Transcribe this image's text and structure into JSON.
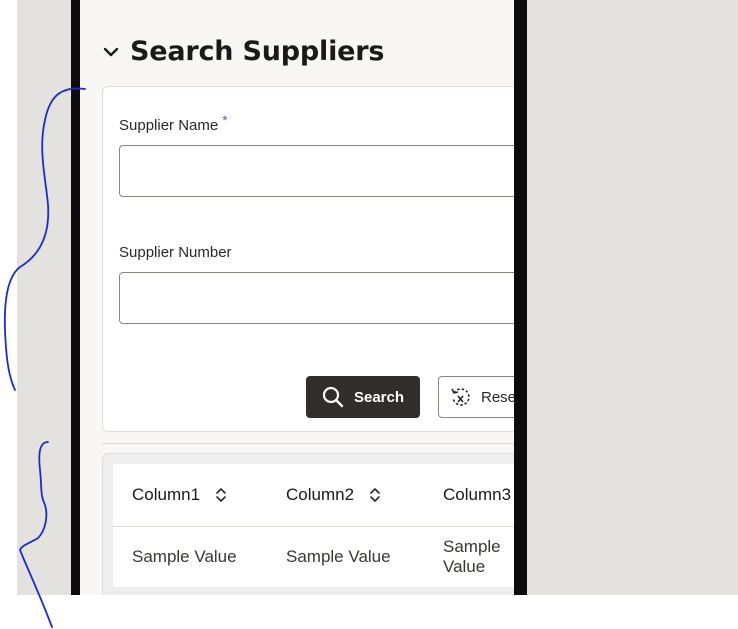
{
  "section": {
    "title": "Search Suppliers",
    "collapse_icon": "chevron-down-icon"
  },
  "form": {
    "supplier_name": {
      "label": "Supplier Name",
      "required_marker": "*",
      "value": ""
    },
    "supplier_number": {
      "label": "Supplier Number",
      "value": ""
    },
    "search_button": {
      "label": "Search",
      "icon": "search-icon"
    },
    "reset_button": {
      "label": "Rese",
      "icon": "reset-icon"
    }
  },
  "table": {
    "columns": [
      {
        "label": "Column1",
        "icon": "sort-icon"
      },
      {
        "label": "Column2",
        "icon": "sort-icon"
      },
      {
        "label": "Column3",
        "icon": "sort-icon"
      }
    ],
    "rows": [
      [
        "Sample Value",
        "Sample Value",
        "Sample Value"
      ]
    ]
  },
  "colors": {
    "primary_button": "#312d2a",
    "required_marker": "#2a7bbd",
    "annotation_ink": "#1e2ad6",
    "background": "#e4e2de",
    "panel": "#f8f7f5"
  }
}
